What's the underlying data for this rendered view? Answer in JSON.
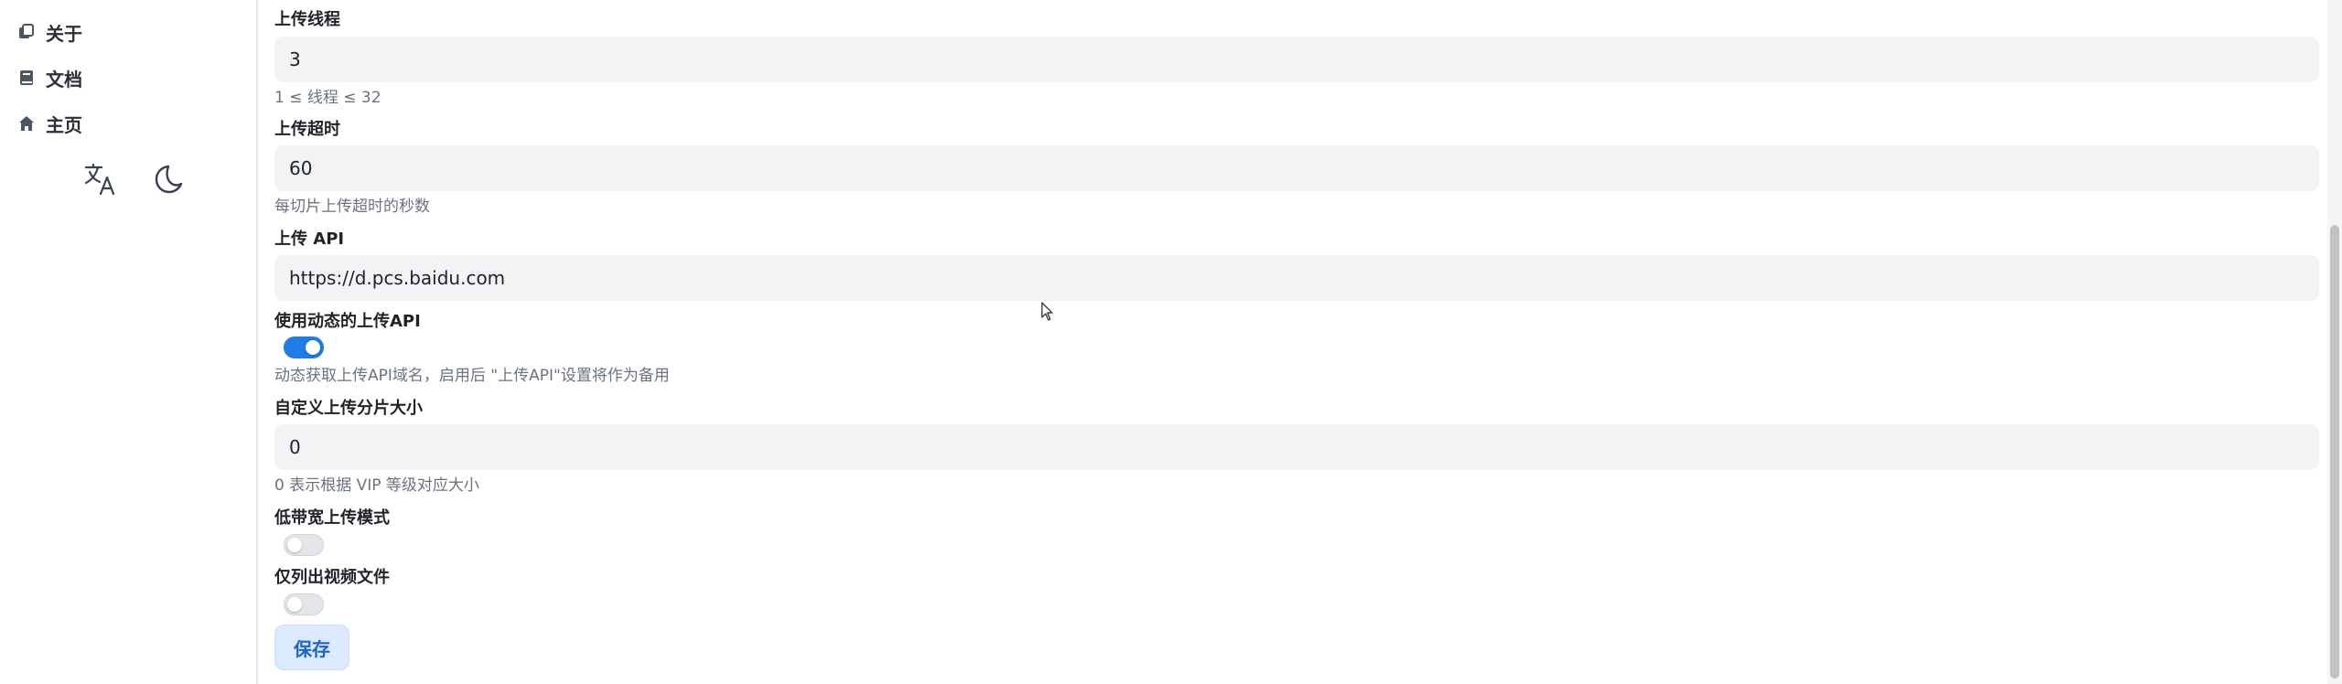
{
  "sidebar": {
    "items": [
      {
        "label": "关于",
        "icon": "about-icon"
      },
      {
        "label": "文档",
        "icon": "book-icon"
      },
      {
        "label": "主页",
        "icon": "home-icon"
      }
    ],
    "actions": [
      {
        "icon": "translate-icon"
      },
      {
        "icon": "moon-icon"
      }
    ]
  },
  "settings": {
    "upload_threads": {
      "label": "上传线程",
      "value": "3",
      "help": "1 ≤ 线程 ≤ 32"
    },
    "upload_timeout": {
      "label": "上传超时",
      "value": "60",
      "help": "每切片上传超时的秒数"
    },
    "upload_api": {
      "label": "上传 API",
      "value": "https://d.pcs.baidu.com"
    },
    "dynamic_api": {
      "label": "使用动态的上传API",
      "enabled": true,
      "help": "动态获取上传API域名，启用后 \"上传API\"设置将作为备用"
    },
    "chunk_size": {
      "label": "自定义上传分片大小",
      "value": "0",
      "help": "0 表示根据 VIP 等级对应大小"
    },
    "low_bandwidth": {
      "label": "低带宽上传模式",
      "enabled": false
    },
    "video_only": {
      "label": "仅列出视频文件",
      "enabled": false
    }
  },
  "save_label": "保存",
  "colors": {
    "accent": "#1e7ce6",
    "input_bg": "#f2f3f5",
    "save_bg": "#dbeafe",
    "help_text": "#6b7280"
  }
}
